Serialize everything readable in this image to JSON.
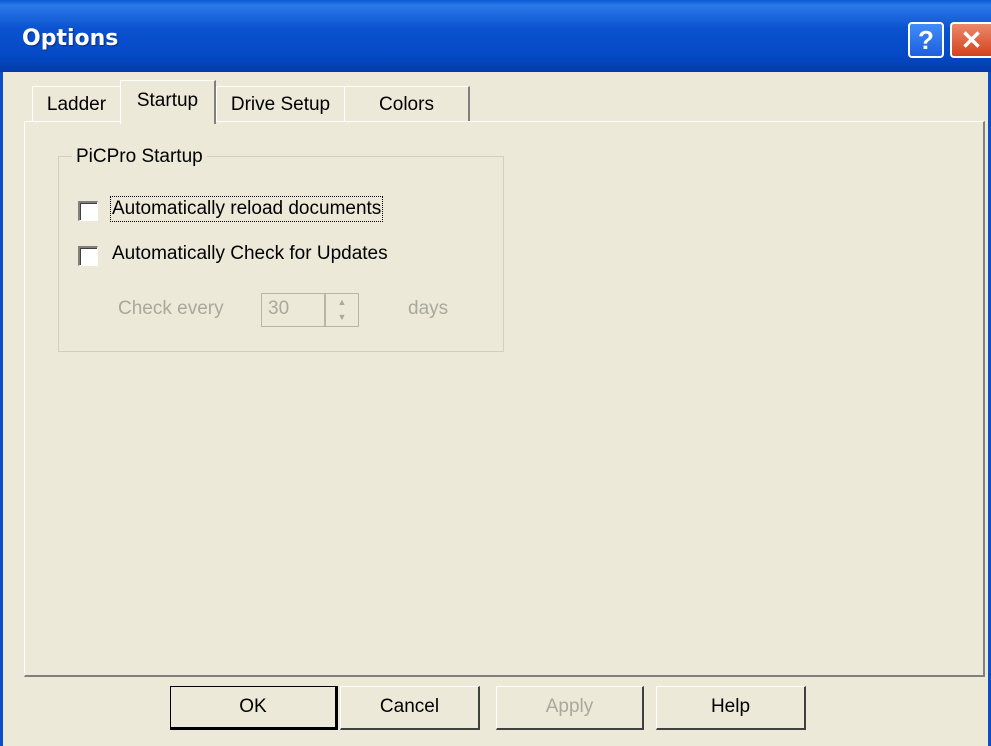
{
  "window": {
    "title": "Options",
    "help_glyph": "?",
    "close_glyph": "✕"
  },
  "tabs": [
    {
      "label": "Ladder"
    },
    {
      "label": "Startup"
    },
    {
      "label": "Drive Setup"
    },
    {
      "label": "Colors"
    }
  ],
  "active_tab": "Startup",
  "startup": {
    "group_label": "PiCPro Startup",
    "reload_label": "Automatically reload documents",
    "reload_checked": false,
    "updates_label": "Automatically Check for Updates",
    "updates_checked": false,
    "check_every_label": "Check every",
    "check_every_value": "30",
    "days_label": "days"
  },
  "buttons": {
    "ok": "OK",
    "cancel": "Cancel",
    "apply": "Apply",
    "help": "Help"
  },
  "colors": {
    "titlebar": "#0a52cf",
    "dialog_bg": "#ece9d8",
    "disabled_text": "#a8a89c"
  }
}
